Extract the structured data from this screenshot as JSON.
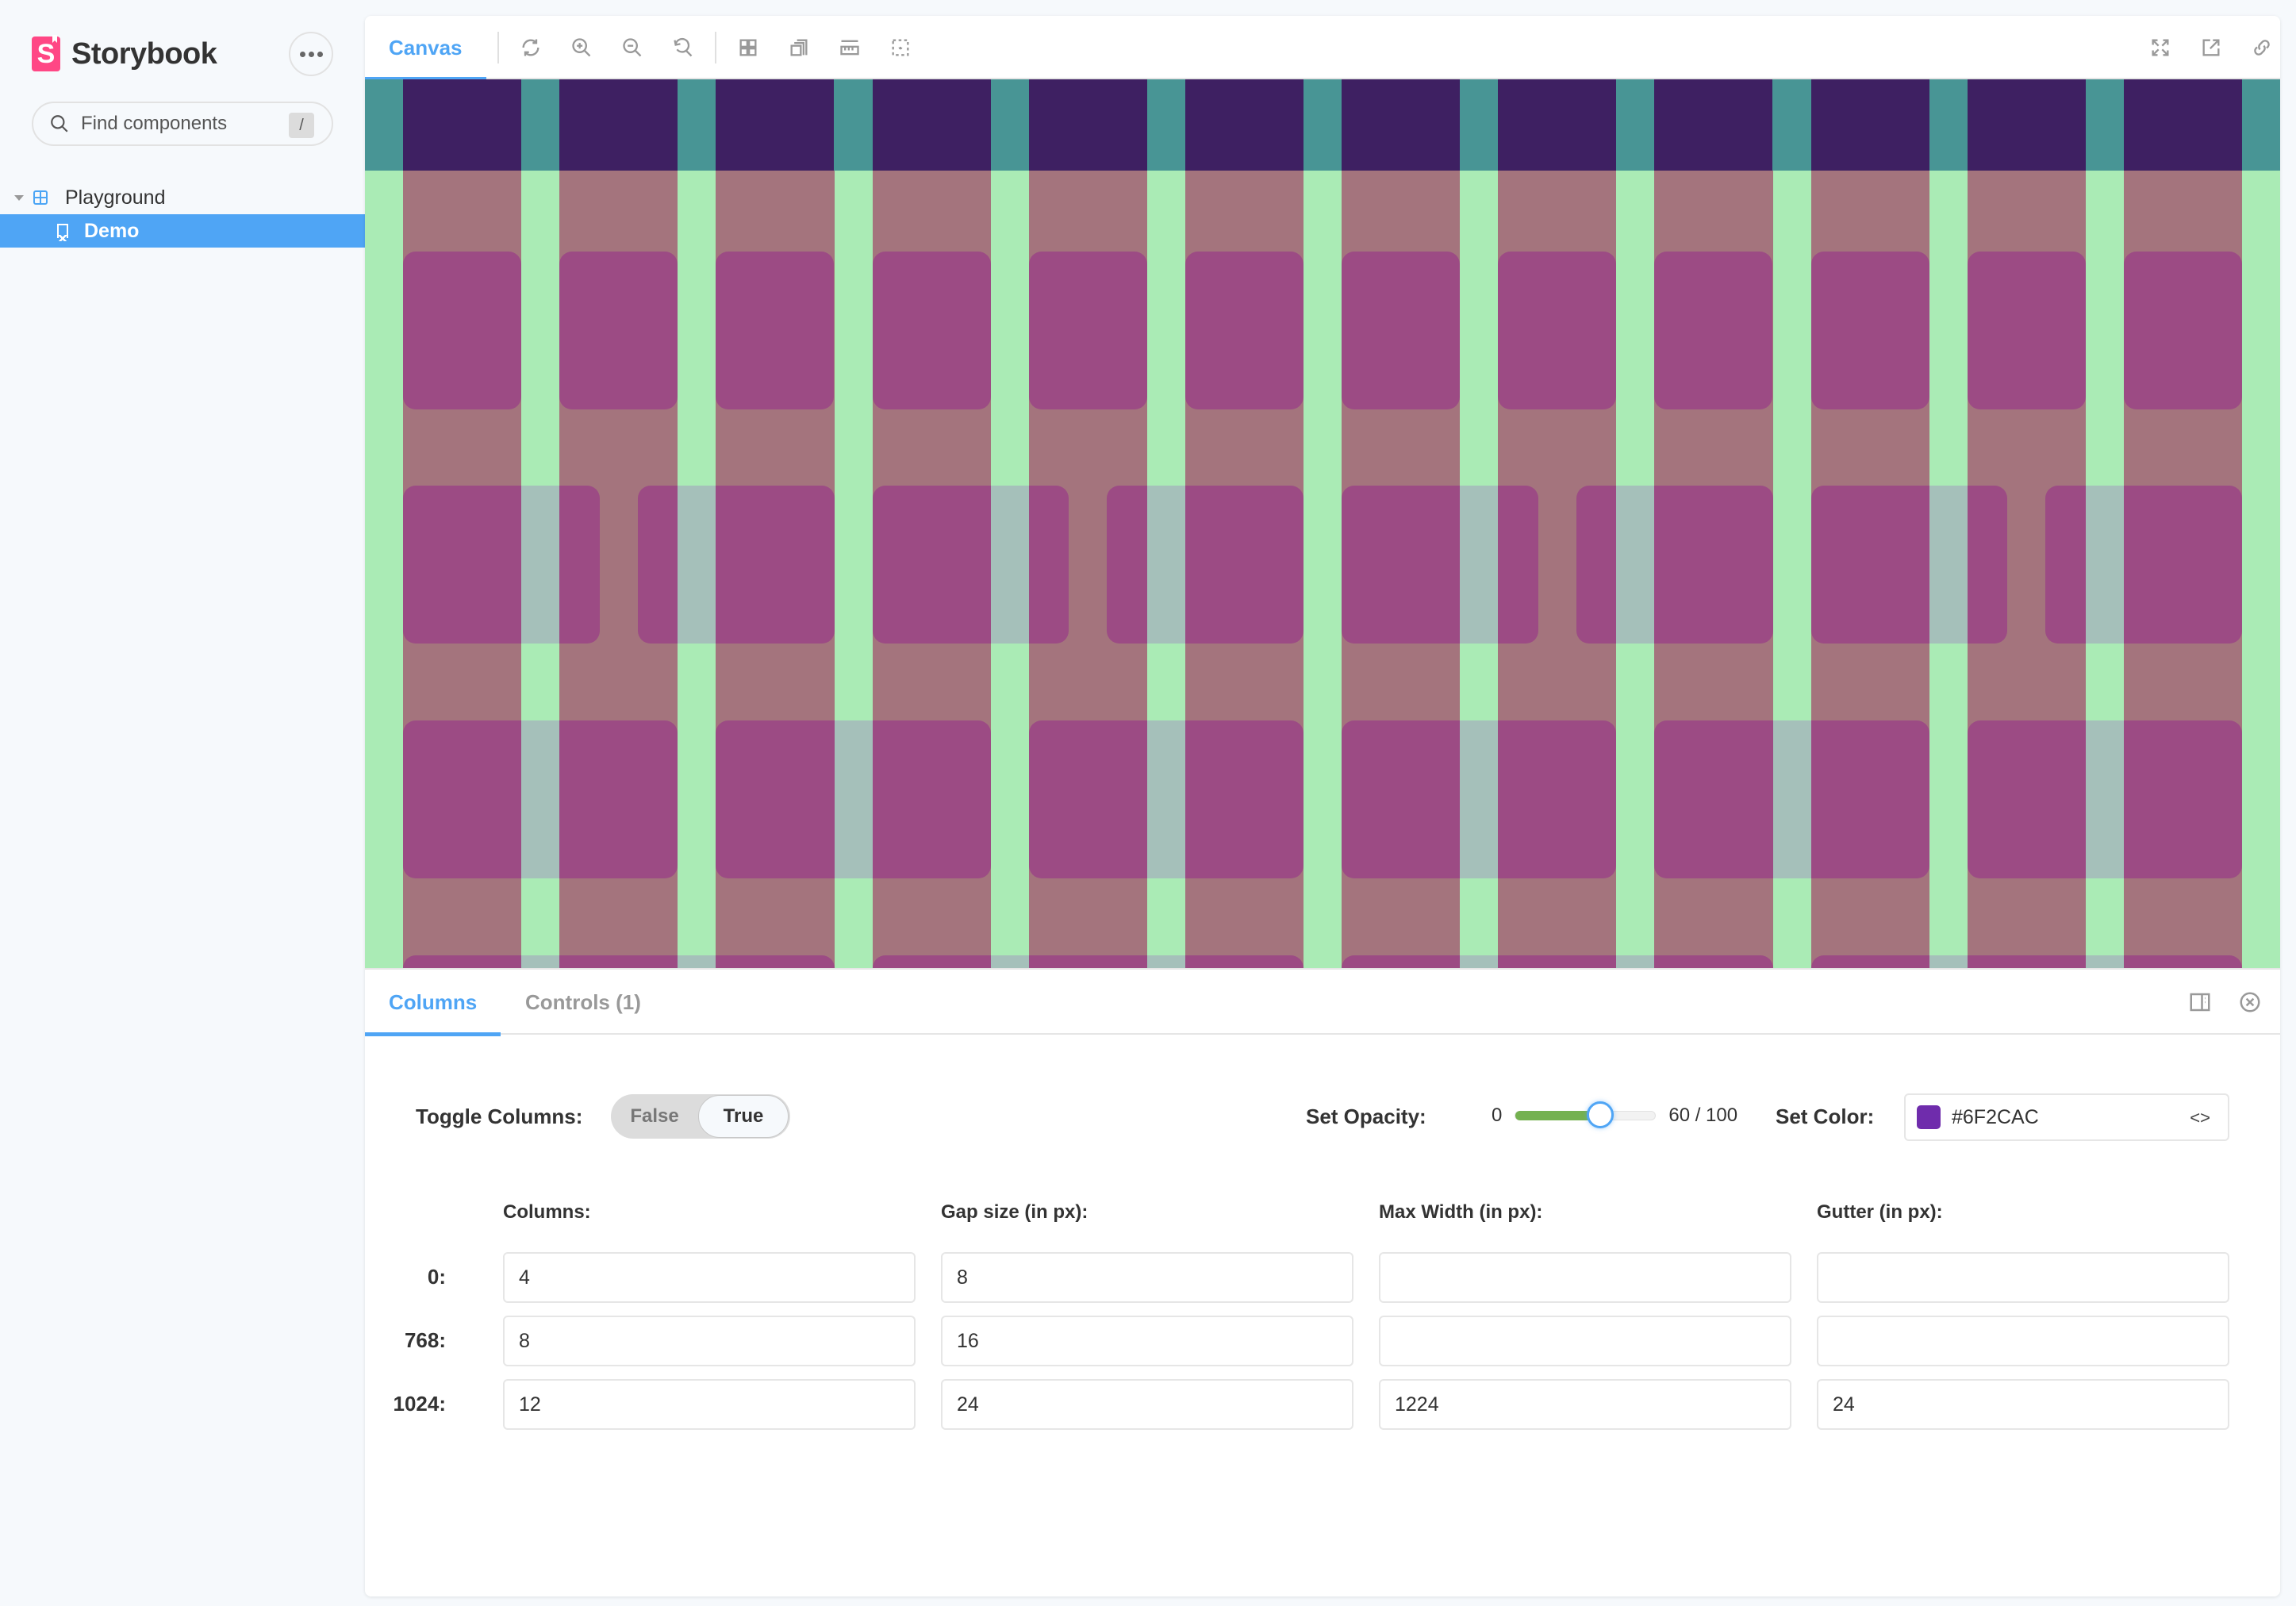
{
  "app": {
    "brand": "Storybook",
    "brand_logo_letter": "S",
    "colors": {
      "accent": "#4FA5F5",
      "brand": "#FF4785",
      "slider_fill": "#74B150"
    }
  },
  "sidebar": {
    "menu_icon": "ellipsis-icon",
    "search": {
      "placeholder": "Find components",
      "shortcut": "/"
    },
    "tree": [
      {
        "label": "Playground",
        "type": "component",
        "expanded": true
      },
      {
        "label": "Demo",
        "type": "story",
        "selected": true
      }
    ]
  },
  "toolbar": {
    "tab": "Canvas",
    "left_icons": [
      "sync-icon",
      "zoom-in-icon",
      "zoom-out-icon",
      "zoom-reset-icon",
      "grid-icon",
      "background-icon",
      "measure-icon",
      "outline-icon"
    ],
    "right_icons": [
      "fullscreen-icon",
      "open-new-tab-icon",
      "copy-link-icon"
    ]
  },
  "canvas": {
    "grid_columns": 12,
    "rows": [
      {
        "box_count": 12,
        "span": 1
      },
      {
        "box_count": 8,
        "span": 1.5
      },
      {
        "box_count": 6,
        "span": 2
      },
      {
        "box_count": 4,
        "span": 3
      }
    ],
    "colors": {
      "background": "#A4747D",
      "top_band": "#489595",
      "top_band_column": "#3E2062",
      "column_overlay": "#AAEBB5",
      "box": "#9C4B84",
      "box_overlap": "#A5C0BA"
    }
  },
  "panel": {
    "tabs": [
      {
        "label": "Columns",
        "active": true
      },
      {
        "label": "Controls (1)",
        "active": false
      }
    ],
    "right_icons": [
      "panel-orientation-icon",
      "close-panel-icon"
    ],
    "toggle_columns": {
      "label": "Toggle Columns:",
      "off_label": "False",
      "on_label": "True",
      "value": true
    },
    "opacity": {
      "label": "Set Opacity:",
      "min_label": "0",
      "value": 60,
      "max": 100,
      "value_label": "60 / 100"
    },
    "color": {
      "label": "Set Color:",
      "value": "#6F2CAC",
      "swatch": "#6F2CAC",
      "toggle_label": "<>"
    },
    "breakpoints": {
      "headers": [
        "Columns:",
        "Gap size (in px):",
        "Max Width (in px):",
        "Gutter (in px):"
      ],
      "rows": [
        {
          "label": "0:",
          "values": [
            "4",
            "8",
            "",
            ""
          ]
        },
        {
          "label": "768:",
          "values": [
            "8",
            "16",
            "",
            ""
          ]
        },
        {
          "label": "1024:",
          "values": [
            "12",
            "24",
            "1224",
            "24"
          ]
        }
      ]
    }
  }
}
